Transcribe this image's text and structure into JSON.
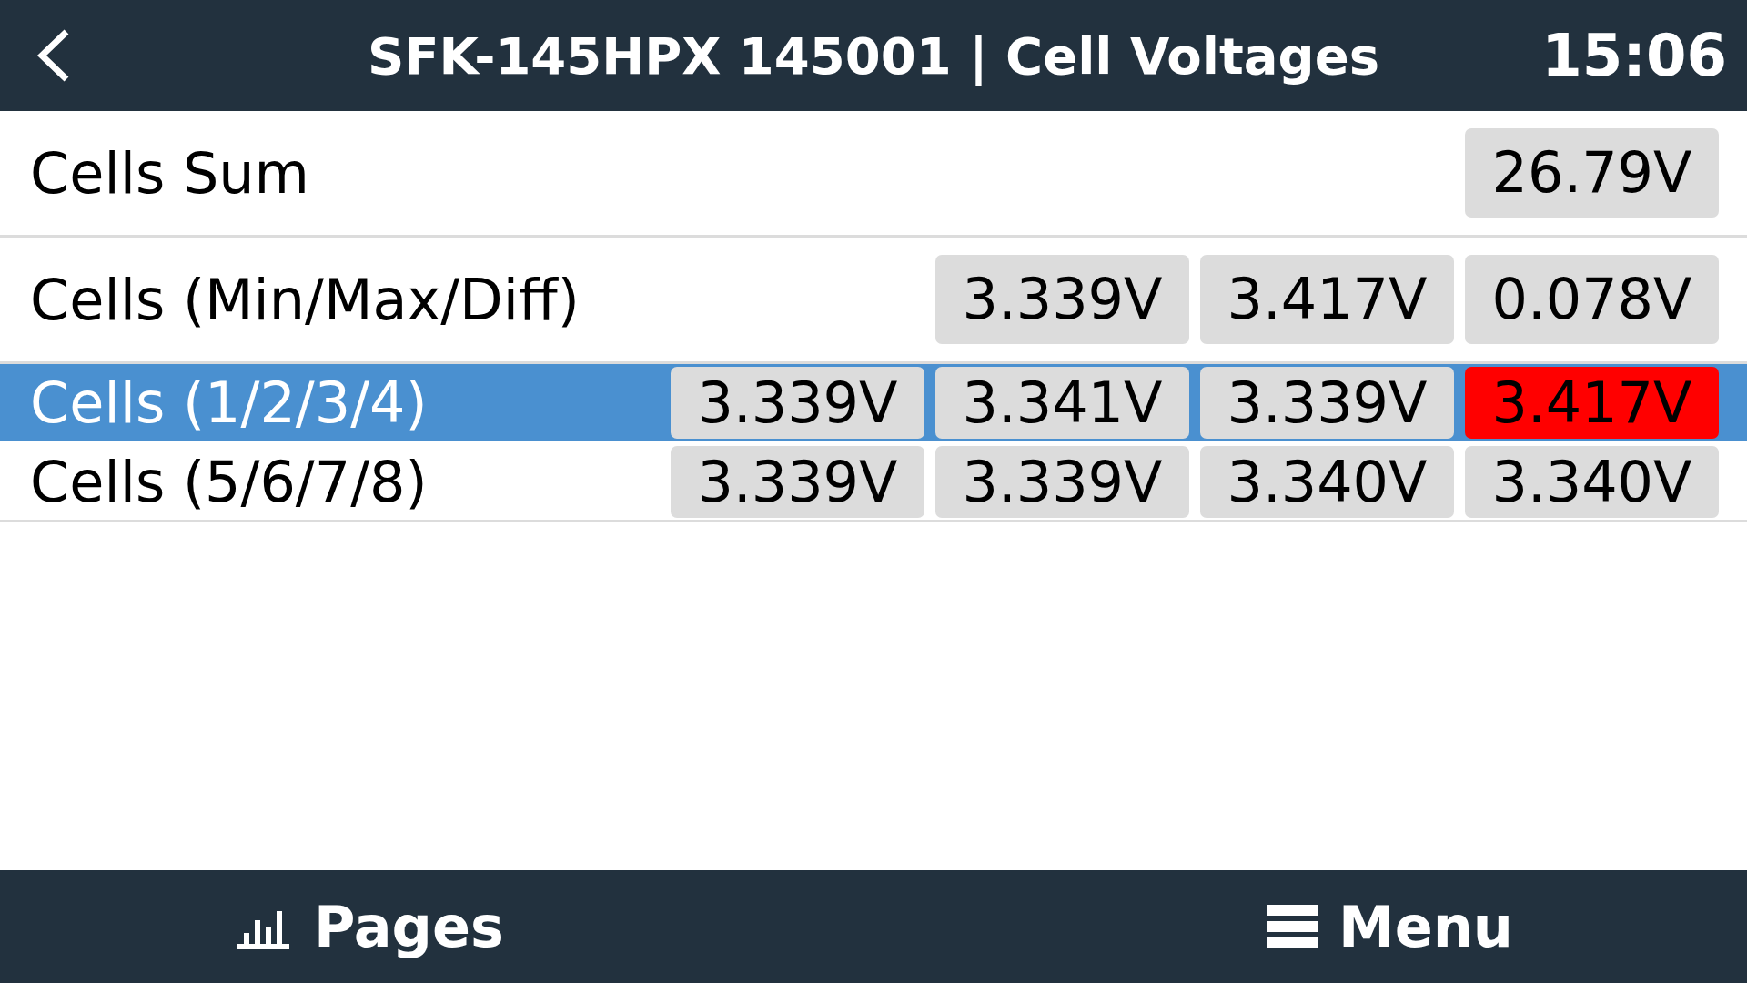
{
  "header": {
    "title": "SFK-145HPX 145001 | Cell Voltages",
    "time": "15:06"
  },
  "rows": [
    {
      "label": "Cells Sum",
      "kind": "tall",
      "selected": false,
      "values": [
        {
          "text": "26.79V",
          "alarm": false
        }
      ]
    },
    {
      "label": "Cells (Min/Max/Diff)",
      "kind": "tall",
      "selected": false,
      "values": [
        {
          "text": "3.339V",
          "alarm": false
        },
        {
          "text": "3.417V",
          "alarm": false
        },
        {
          "text": "0.078V",
          "alarm": false
        }
      ]
    },
    {
      "label": "Cells (1/2/3/4)",
      "kind": "compact",
      "selected": true,
      "values": [
        {
          "text": "3.339V",
          "alarm": false
        },
        {
          "text": "3.341V",
          "alarm": false
        },
        {
          "text": "3.339V",
          "alarm": false
        },
        {
          "text": "3.417V",
          "alarm": true
        }
      ]
    },
    {
      "label": "Cells (5/6/7/8)",
      "kind": "compact",
      "selected": false,
      "values": [
        {
          "text": "3.339V",
          "alarm": false
        },
        {
          "text": "3.339V",
          "alarm": false
        },
        {
          "text": "3.340V",
          "alarm": false
        },
        {
          "text": "3.340V",
          "alarm": false
        }
      ]
    }
  ],
  "footer": {
    "pages": "Pages",
    "menu": "Menu"
  }
}
